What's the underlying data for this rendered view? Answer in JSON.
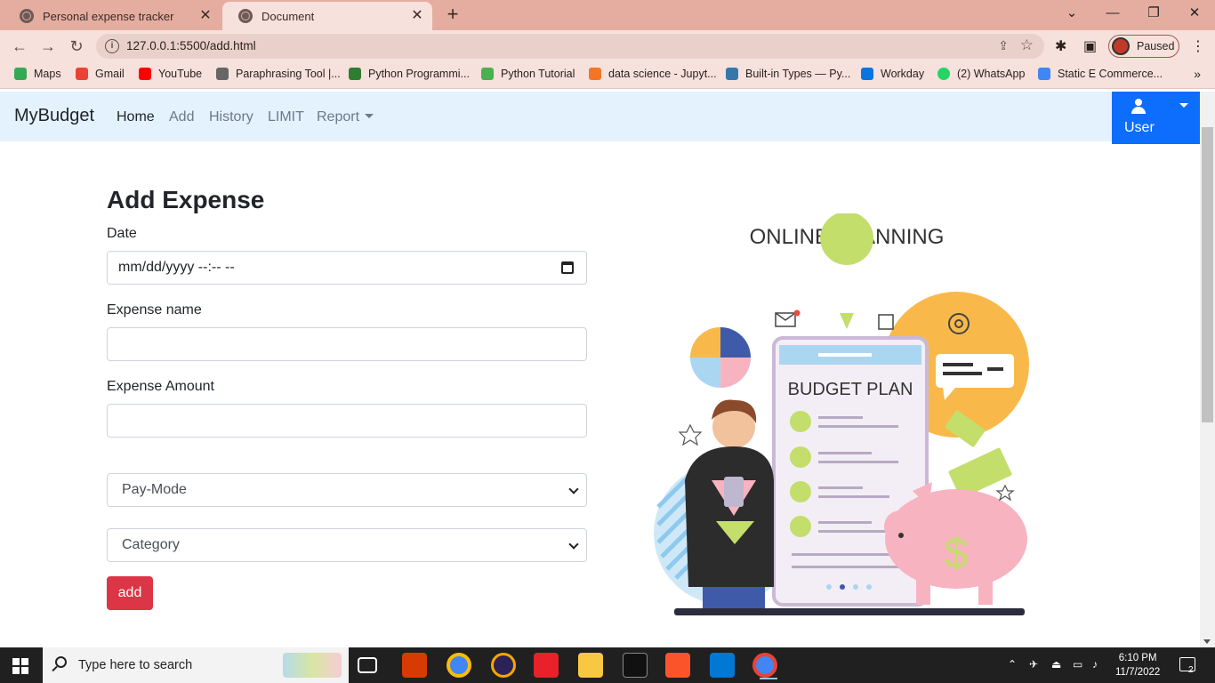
{
  "browser": {
    "tabs": [
      {
        "title": "Personal expense tracker",
        "active": false
      },
      {
        "title": "Document",
        "active": true
      }
    ],
    "url": "127.0.0.1:5500/add.html",
    "profile_label": "Paused",
    "bookmarks": [
      {
        "label": "Maps",
        "color": "#34a853"
      },
      {
        "label": "Gmail",
        "color": "#ea4335"
      },
      {
        "label": "YouTube",
        "color": "#ff0000"
      },
      {
        "label": "Paraphrasing Tool |...",
        "color": "#666666"
      },
      {
        "label": "Python Programmi...",
        "color": "#2e7d32"
      },
      {
        "label": "Python Tutorial",
        "color": "#4caf50"
      },
      {
        "label": "data science - Jupyt...",
        "color": "#f37626"
      },
      {
        "label": "Built-in Types — Py...",
        "color": "#3776ab"
      },
      {
        "label": "Workday",
        "color": "#0875e1"
      },
      {
        "label": "(2) WhatsApp",
        "color": "#25d366"
      },
      {
        "label": "Static E Commerce...",
        "color": "#4285f4"
      }
    ]
  },
  "navbar": {
    "brand": "MyBudget",
    "links": [
      {
        "label": "Home",
        "active": true
      },
      {
        "label": "Add",
        "active": false
      },
      {
        "label": "History",
        "active": false
      },
      {
        "label": "LIMIT",
        "active": false
      },
      {
        "label": "Report",
        "active": false,
        "dropdown": true
      }
    ],
    "user_label": "User"
  },
  "form": {
    "title": "Add Expense",
    "date_label": "Date",
    "date_placeholder": "mm/dd/yyyy  --:-- --",
    "name_label": "Expense name",
    "name_value": "",
    "amount_label": "Expense Amount",
    "amount_value": "",
    "paymode_selected": "Pay-Mode",
    "category_selected": "Category",
    "submit_label": "add"
  },
  "illustration": {
    "heading": "ONLINE PLANNING",
    "card_title": "BUDGET PLAN"
  },
  "taskbar": {
    "search_placeholder": "Type here to search",
    "time": "6:10 PM",
    "date": "11/7/2022",
    "notification_count": "2"
  },
  "colors": {
    "tabstrip": "#e4ada0",
    "toolbar": "#f6e1dc",
    "navbar_bg": "#e3f2fd",
    "user_button": "#0d6efd",
    "add_button": "#dc3545"
  }
}
